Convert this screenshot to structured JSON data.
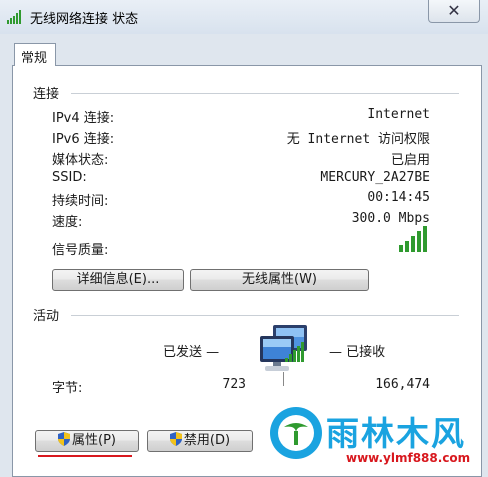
{
  "window": {
    "title": "无线网络连接 状态",
    "close_glyph": "✕"
  },
  "tab": {
    "label": "常规"
  },
  "connection": {
    "section_title": "连接",
    "rows": [
      {
        "label": "IPv4 连接:",
        "value": "Internet"
      },
      {
        "label": "IPv6 连接:",
        "value": "无 Internet 访问权限"
      },
      {
        "label": "媒体状态:",
        "value": "已启用"
      },
      {
        "label": "SSID:",
        "value": "MERCURY_2A27BE"
      },
      {
        "label": "持续时间:",
        "value": "00:14:45"
      },
      {
        "label": "速度:",
        "value": "300.0 Mbps"
      }
    ],
    "signal_label": "信号质量:",
    "signal_bars": 5,
    "signal_color": "#2f9a2f"
  },
  "buttons": {
    "details": "详细信息(E)...",
    "wireless_properties": "无线属性(W)",
    "properties": "属性(P)",
    "disable": "禁用(D)"
  },
  "activity": {
    "section_title": "活动",
    "sent_label": "已发送 —",
    "received_label": "— 已接收",
    "bytes_label": "字节:",
    "bytes_sent": "723",
    "bytes_received": "166,474"
  },
  "watermark": {
    "brand": "雨林木风",
    "url": "www.ylmf888.com",
    "brand_color": "#1aa3e0",
    "url_color": "#d8181e"
  },
  "colors": {
    "accent_underline": "#d8181e",
    "shield_blue": "#2f62c4",
    "shield_yellow": "#f2c21b"
  }
}
